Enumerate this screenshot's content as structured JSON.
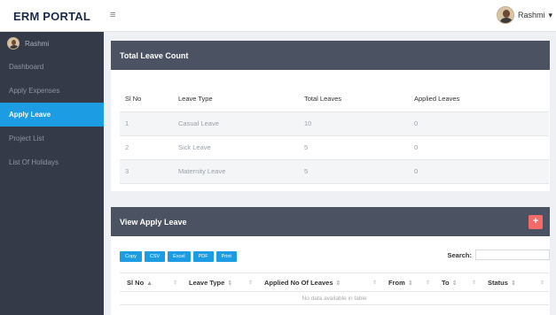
{
  "header": {
    "brand": "ERM PORTAL",
    "menu_icon": "hamburger-icon",
    "user_name": "Rashmi"
  },
  "sidebar": {
    "user_name": "Rashmi",
    "items": [
      {
        "label": "Dashboard",
        "active": false
      },
      {
        "label": "Apply Expenses",
        "active": false
      },
      {
        "label": "Apply Leave",
        "active": true
      },
      {
        "label": "Project List",
        "active": false
      },
      {
        "label": "List Of Holidays",
        "active": false
      }
    ]
  },
  "leave_count": {
    "title": "Total Leave Count",
    "columns": [
      "Sl No",
      "Leave Type",
      "Total Leaves",
      "Applied Leaves"
    ],
    "rows": [
      [
        "1",
        "Casual Leave",
        "10",
        "0"
      ],
      [
        "2",
        "Sick Leave",
        "5",
        "0"
      ],
      [
        "3",
        "Maternity Leave",
        "5",
        "0"
      ]
    ]
  },
  "apply_leave": {
    "title": "View Apply Leave",
    "add_label": "+",
    "export_buttons": [
      "Copy",
      "CSV",
      "Excel",
      "PDF",
      "Print"
    ],
    "search_label": "Search:",
    "search_value": "",
    "columns": [
      "Sl No",
      "Leave Type",
      "Applied No Of Leaves",
      "From",
      "To",
      "Status"
    ],
    "empty_message": "No data available in table"
  },
  "colors": {
    "accent": "#1b9ce3",
    "sidebar_bg": "#343a47",
    "panel_header": "#4b5362",
    "add_button": "#f26a6a"
  }
}
